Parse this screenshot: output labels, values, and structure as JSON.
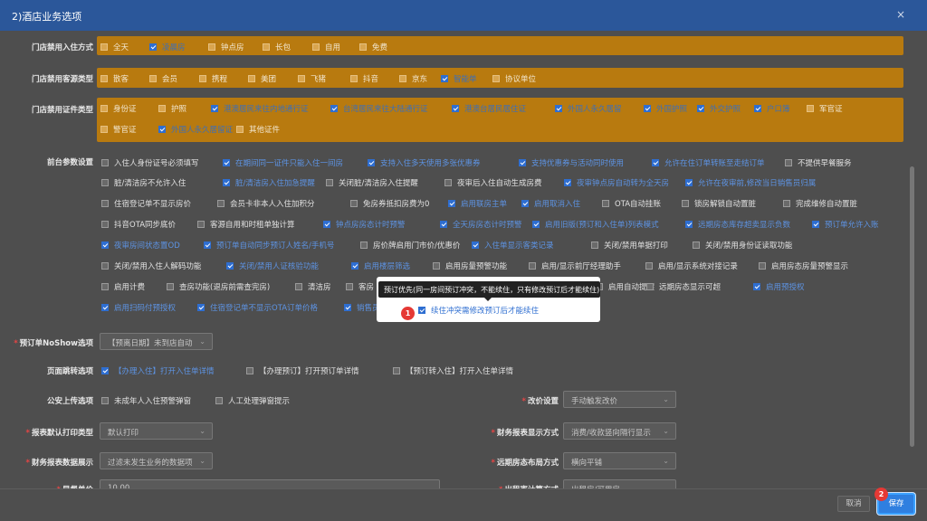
{
  "dialog": {
    "title": "2)酒店业务选项",
    "close": "×"
  },
  "checkin_mode": {
    "label": "门店禁用入住方式",
    "options": [
      {
        "t": "全天",
        "on": false
      },
      {
        "t": "凌晨房",
        "on": true
      },
      {
        "t": "钟点房",
        "on": false
      },
      {
        "t": "长包",
        "on": false
      },
      {
        "t": "自用",
        "on": false
      },
      {
        "t": "免费",
        "on": false
      }
    ]
  },
  "source_type": {
    "label": "门店禁用客源类型",
    "options": [
      {
        "t": "散客",
        "on": false
      },
      {
        "t": "会员",
        "on": false
      },
      {
        "t": "携程",
        "on": false
      },
      {
        "t": "美团",
        "on": false
      },
      {
        "t": "飞猪",
        "on": false
      },
      {
        "t": "抖音",
        "on": false
      },
      {
        "t": "京东",
        "on": false
      },
      {
        "t": "智能单",
        "on": true
      },
      {
        "t": "协议单位",
        "on": false
      }
    ]
  },
  "id_type": {
    "label": "门店禁用证件类型",
    "options": [
      {
        "t": "身份证",
        "on": false
      },
      {
        "t": "护照",
        "on": false
      },
      {
        "t": "港澳居民来往内地通行证",
        "on": true
      },
      {
        "t": "台湾居民来往大陆通行证",
        "on": true
      },
      {
        "t": "港澳台居民居住证",
        "on": true
      },
      {
        "t": "外国人永久居留",
        "on": true
      },
      {
        "t": "外国护照",
        "on": true
      },
      {
        "t": "外交护照",
        "on": true
      },
      {
        "t": "户口簿",
        "on": true
      },
      {
        "t": "军官证",
        "on": false
      },
      {
        "t": "警官证",
        "on": false
      },
      {
        "t": "外国人永久居留证",
        "on": true
      },
      {
        "t": "其他证件",
        "on": false
      }
    ]
  },
  "frontdesk": {
    "label": "前台参数设置",
    "rows": [
      [
        {
          "t": "入住人身份证号必须填写",
          "on": false
        },
        {
          "t": "在期间同一证件只能入住一间房",
          "on": true
        },
        {
          "t": "支持入住多天使用多张优惠券",
          "on": true
        },
        {
          "t": "支持优惠券与活动同时使用",
          "on": true
        },
        {
          "t": "允许在住订单转账至走结订单",
          "on": true
        },
        {
          "t": "不提供早餐服务",
          "on": false
        }
      ],
      [
        {
          "t": "脏/清洁房不允许入住",
          "on": false
        },
        {
          "t": "脏/清洁房入住加急提醒",
          "on": true
        },
        {
          "t": "关闭脏/清洁房入住提醒",
          "on": false
        },
        {
          "t": "夜审后入住自动生成房费",
          "on": false
        },
        {
          "t": "夜审钟点房自动转为全天房",
          "on": true
        },
        {
          "t": "允许在夜审前,修改当日销售员归属",
          "on": true
        }
      ],
      [
        {
          "t": "住宿登记单不显示房价",
          "on": false
        },
        {
          "t": "会员卡非本人入住加积分",
          "on": false
        },
        {
          "t": "免房券抵扣房费为0",
          "on": false
        },
        {
          "t": "启用联房主单",
          "on": true
        },
        {
          "t": "启用取消入住",
          "on": true
        },
        {
          "t": "OTA自动挂账",
          "on": false
        },
        {
          "t": "锁房解锁自动置脏",
          "on": false
        },
        {
          "t": "完成维修自动置脏",
          "on": false
        }
      ],
      [
        {
          "t": "抖音OTA同步底价",
          "on": false
        },
        {
          "t": "客源自用和时租单独计算",
          "on": false
        },
        {
          "t": "钟点房房态计时预警",
          "on": true
        },
        {
          "t": "全天房房态计时预警",
          "on": true
        },
        {
          "t": "启用旧版(预订和入住单)列表模式",
          "on": true
        },
        {
          "t": "远期房态库存超卖显示负数",
          "on": true
        },
        {
          "t": "预订单允许入账",
          "on": true
        }
      ],
      [
        {
          "t": "夜审房间状态置OD",
          "on": true
        },
        {
          "t": "预订单自动同步预订人姓名/手机号",
          "on": true
        },
        {
          "t": "房价牌启用门市价/优惠价",
          "on": false
        },
        {
          "t": "入住单显示客类记录",
          "on": true
        },
        {
          "t": "关闭/禁用单据打印",
          "on": false
        },
        {
          "t": "关闭/禁用身份证读取功能",
          "on": false
        }
      ],
      [
        {
          "t": "关闭/禁用入住人解码功能",
          "on": false
        },
        {
          "t": "关闭/禁用人证核验功能",
          "on": true
        },
        {
          "t": "启用楼层筛选",
          "on": true
        },
        {
          "t": "启用房量预警功能",
          "on": false
        },
        {
          "t": "启用/显示前厅经理助手",
          "on": false
        },
        {
          "t": "启用/显示系统对接记录",
          "on": false
        },
        {
          "t": "启用房态房量预警显示",
          "on": false
        }
      ],
      [
        {
          "t": "启用计费",
          "on": false
        },
        {
          "t": "查房功能(退房前需查完房)",
          "on": false
        },
        {
          "t": "清洁房",
          "on": false
        },
        {
          "t": "客房",
          "on": false
        },
        {
          "t": "启用自动提醒",
          "on": false
        },
        {
          "t": "远期房态显示可超",
          "on": false
        },
        {
          "t": "启用预授权",
          "on": true
        }
      ],
      [
        {
          "t": "启用扫码付预授权",
          "on": true
        },
        {
          "t": "住宿登记单不显示OTA订单价格",
          "on": true
        },
        {
          "t": "销售员默认",
          "on": true
        },
        {
          "t": "续住冲突需修改预订后才能续住",
          "on": true
        }
      ]
    ]
  },
  "popup": {
    "tooltip": "预订优先(同一房间预订冲突，不能续住，只有修改预订后才能续住)",
    "badge1": "1"
  },
  "noshow": {
    "label": "预订单NoShow选项",
    "value": "【预离日期】未到店自动"
  },
  "page_jump": {
    "label": "页面跳转选项",
    "options": [
      {
        "t": "【办理入住】打开入住单详情",
        "on": true
      },
      {
        "t": "【办理预订】打开预订单详情",
        "on": false
      },
      {
        "t": "【预订转入住】打开入住单详情",
        "on": false
      }
    ]
  },
  "police": {
    "label": "公安上传选项",
    "options": [
      {
        "t": "未成年人入住预警弹窗",
        "on": false
      },
      {
        "t": "人工处理弹窗提示",
        "on": false
      }
    ]
  },
  "price_change": {
    "label": "改价设置",
    "value": "手动触发改价"
  },
  "report_print": {
    "label": "报表默认打印类型",
    "value": "默认打印"
  },
  "finance_display": {
    "label": "财务报表显示方式",
    "value": "消费/收款竖向隔行显示"
  },
  "finance_data": {
    "label": "财务报表数据展示",
    "value": "过滤未发生业务的数据项"
  },
  "forward_layout": {
    "label": "远期房态布局方式",
    "value": "横向平铺"
  },
  "cut_row": {
    "label_left": "早餐单价",
    "value_left": "10.00",
    "label_right": "出租率计算方式",
    "value_right": "出租房/可用房"
  },
  "footer": {
    "cancel": "取消",
    "save": "保存",
    "badge2": "2"
  }
}
